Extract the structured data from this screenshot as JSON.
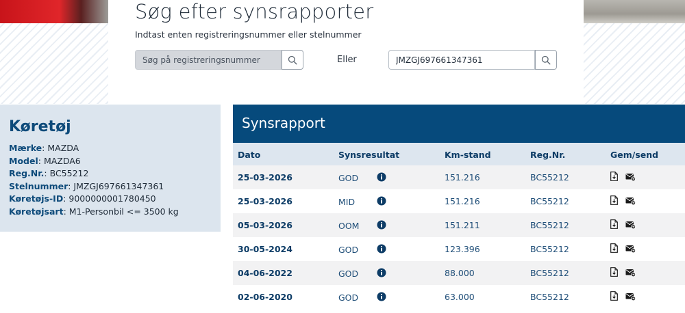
{
  "search": {
    "title": "Søg efter synsrapporter",
    "subtitle": "Indtast enten registreringsnummer eller stelnummer",
    "reg_placeholder": "Søg på registreringsnummer",
    "reg_value": "",
    "or_label": "Eller",
    "vin_value": "JMZGJ697661347361",
    "search_icon": "search-icon"
  },
  "vehicle": {
    "title": "Køretøj",
    "rows": [
      {
        "key": "Mærke",
        "sep": ": ",
        "value": "MAZDA"
      },
      {
        "key": "Model",
        "sep": ": ",
        "value": "MAZDA6"
      },
      {
        "key": "Reg.Nr.",
        "sep": ": ",
        "value": "BC55212"
      },
      {
        "key": "Stelnummer",
        "sep": ": ",
        "value": "JMZGJ697661347361"
      },
      {
        "key": "Køretøjs-ID",
        "sep": ": ",
        "value": "9000000001780450"
      },
      {
        "key": "Køretøjsart",
        "sep": ": ",
        "value": "M1-Personbil <= 3500 kg"
      }
    ]
  },
  "report": {
    "title": "Synsrapport",
    "columns": [
      "Dato",
      "Synsresultat",
      "Km-stand",
      "Reg.Nr.",
      "Gem/send"
    ],
    "rows": [
      {
        "date": "25-03-2026",
        "result": "GOD",
        "km": "151.216",
        "reg": "BC55212"
      },
      {
        "date": "25-03-2026",
        "result": "MID",
        "km": "151.216",
        "reg": "BC55212"
      },
      {
        "date": "05-03-2026",
        "result": "OOM",
        "km": "151.211",
        "reg": "BC55212"
      },
      {
        "date": "30-05-2024",
        "result": "GOD",
        "km": "123.396",
        "reg": "BC55212"
      },
      {
        "date": "04-06-2022",
        "result": "GOD",
        "km": "88.000",
        "reg": "BC55212"
      },
      {
        "date": "02-06-2020",
        "result": "GOD",
        "km": "63.000",
        "reg": "BC55212"
      }
    ],
    "icons": {
      "info": "info-icon",
      "save": "download-document-icon",
      "send": "send-mail-icon"
    }
  },
  "colors": {
    "primary": "#064a7c",
    "panel": "#dce5ee",
    "header_row": "#dde6ef",
    "stripe": "#f2f2f3"
  }
}
